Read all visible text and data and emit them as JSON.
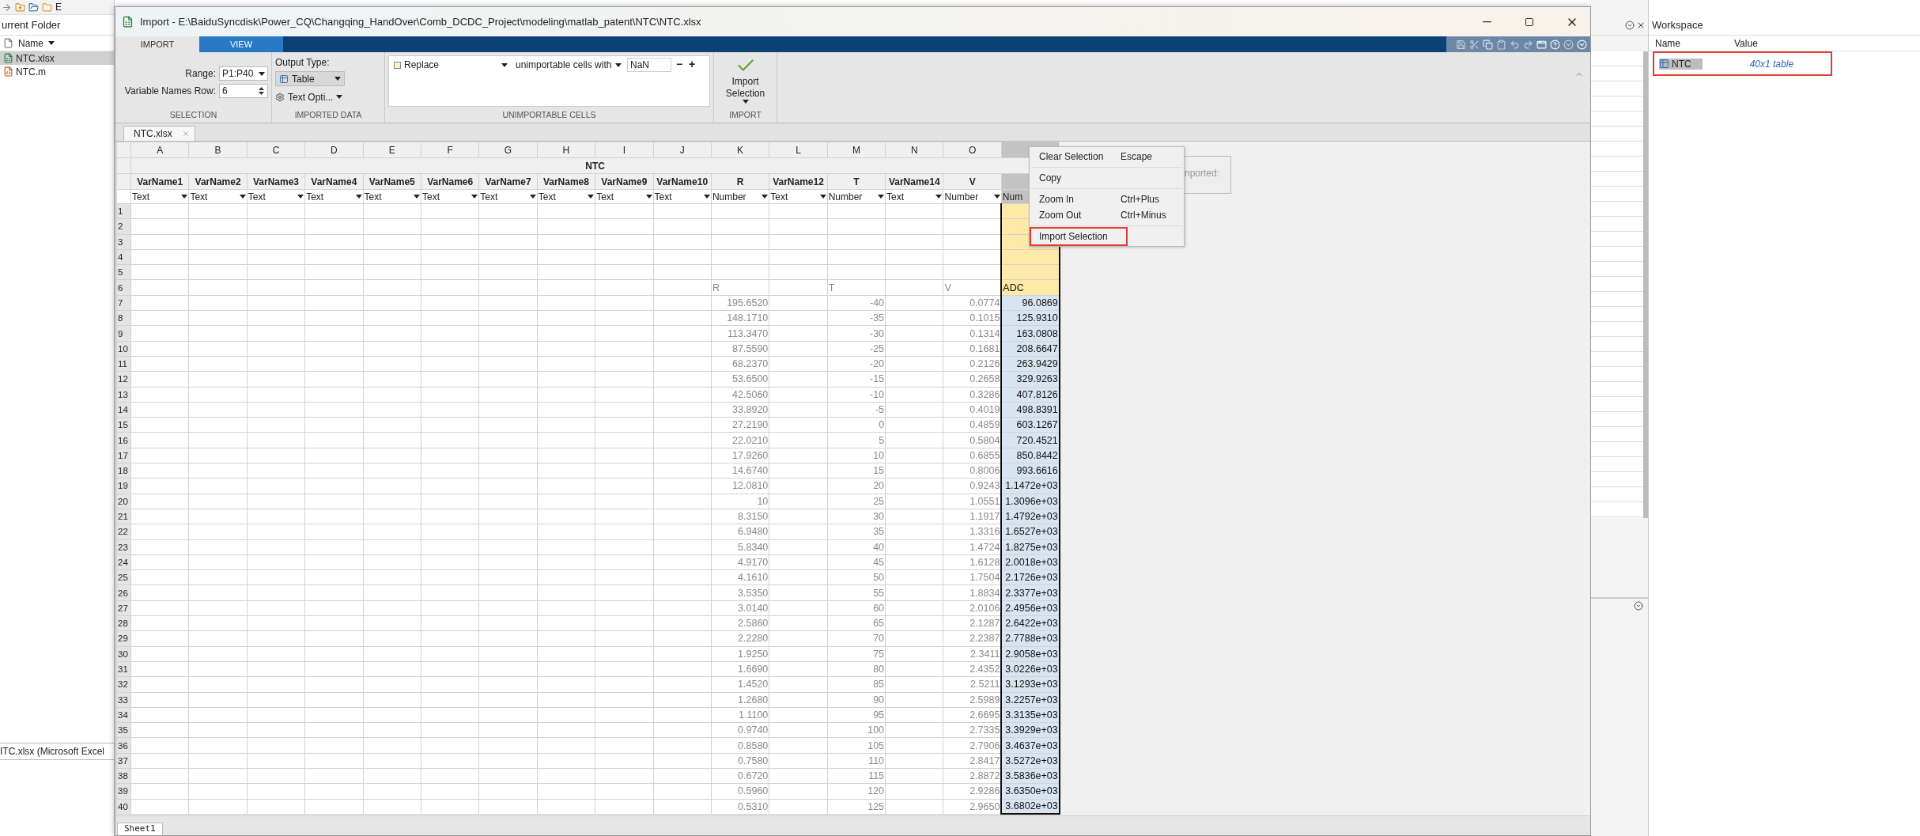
{
  "desktop": {
    "path_fragment": "E",
    "current_folder": {
      "title": "urrent Folder",
      "column": "Name",
      "files": [
        {
          "name": "NTC.xlsx",
          "kind": "excel",
          "selected": true
        },
        {
          "name": "NTC.m",
          "kind": "mfile",
          "selected": false
        }
      ],
      "details": "ITC.xlsx  (Microsoft Excel"
    },
    "workspace": {
      "title": "Workspace",
      "columns": [
        "Name",
        "Value"
      ],
      "variables": [
        {
          "name": "NTC",
          "value": "40x1 table",
          "selected": true,
          "highlighted": true
        }
      ]
    }
  },
  "dialog": {
    "title": "Import - E:\\BaiduSyncdisk\\Power_CQ\\Changqing_HandOver\\Comb_DCDC_Project\\modeling\\matlab_patent\\NTC\\NTC.xlsx",
    "tabs": [
      {
        "label": "IMPORT",
        "selected": true
      },
      {
        "label": "VIEW",
        "selected": false
      }
    ],
    "ribbon": {
      "range_label": "Range:",
      "range": "P1:P40",
      "names_row_label": "Variable Names Row:",
      "names_row": "6",
      "selection_section": "SELECTION",
      "output_label": "Output Type:",
      "output_type": "Table",
      "text_options": "Text Opti...",
      "imported_section": "IMPORTED DATA",
      "rule_action": "Replace",
      "rule_target": "unimportable cells with",
      "rule_value": "NaN",
      "remove": "−",
      "add": "+",
      "unimportable_section": "UNIMPORTABLE CELLS",
      "import_button": "Import Selection",
      "import_section": "IMPORT"
    },
    "document_tabs": [
      {
        "label": "NTC.xlsx",
        "selected": true
      }
    ],
    "sheet": {
      "title": "NTC",
      "columns": [
        {
          "letter": "A",
          "var_name": "VarName1",
          "type": "Text",
          "selected": false
        },
        {
          "letter": "B",
          "var_name": "VarName2",
          "type": "Text",
          "selected": false
        },
        {
          "letter": "C",
          "var_name": "VarName3",
          "type": "Text",
          "selected": false
        },
        {
          "letter": "D",
          "var_name": "VarName4",
          "type": "Text",
          "selected": false
        },
        {
          "letter": "E",
          "var_name": "VarName5",
          "type": "Text",
          "selected": false
        },
        {
          "letter": "F",
          "var_name": "VarName6",
          "type": "Text",
          "selected": false
        },
        {
          "letter": "G",
          "var_name": "VarName7",
          "type": "Text",
          "selected": false
        },
        {
          "letter": "H",
          "var_name": "VarName8",
          "type": "Text",
          "selected": false
        },
        {
          "letter": "I",
          "var_name": "VarName9",
          "type": "Text",
          "selected": false
        },
        {
          "letter": "J",
          "var_name": "VarName10",
          "type": "Text",
          "selected": false
        },
        {
          "letter": "K",
          "var_name": "R",
          "type": "Number",
          "selected": false
        },
        {
          "letter": "L",
          "var_name": "VarName12",
          "type": "Text",
          "selected": false
        },
        {
          "letter": "M",
          "var_name": "T",
          "type": "Number",
          "selected": false
        },
        {
          "letter": "N",
          "var_name": "VarName14",
          "type": "Text",
          "selected": false
        },
        {
          "letter": "O",
          "var_name": "V",
          "type": "Number",
          "selected": false
        },
        {
          "type": "Num",
          "selected": true
        }
      ],
      "rows": [
        {
          "number": "1",
          "kind": "header"
        },
        {
          "number": "2",
          "kind": "header"
        },
        {
          "number": "3",
          "kind": "header"
        },
        {
          "number": "4",
          "kind": "header"
        },
        {
          "number": "5",
          "kind": "header"
        },
        {
          "number": "6",
          "kind": "header",
          "values": {
            "K": "R",
            "M": "T",
            "O": "V",
            "P": "ADC"
          }
        },
        {
          "number": "7",
          "kind": "data",
          "values": {
            "K": "195.6520",
            "M": "-40",
            "O": "0.0774",
            "P": "96.0869"
          }
        },
        {
          "number": "8",
          "kind": "data",
          "values": {
            "K": "148.1710",
            "M": "-35",
            "O": "0.1015",
            "P": "125.9310"
          }
        },
        {
          "number": "9",
          "kind": "data",
          "values": {
            "K": "113.3470",
            "M": "-30",
            "O": "0.1314",
            "P": "163.0808"
          }
        },
        {
          "number": "10",
          "kind": "data",
          "values": {
            "K": "87.5590",
            "M": "-25",
            "O": "0.1681",
            "P": "208.6647"
          }
        },
        {
          "number": "11",
          "kind": "data",
          "values": {
            "K": "68.2370",
            "M": "-20",
            "O": "0.2126",
            "P": "263.9429"
          }
        },
        {
          "number": "12",
          "kind": "data",
          "values": {
            "K": "53.6500",
            "M": "-15",
            "O": "0.2658",
            "P": "329.9263"
          }
        },
        {
          "number": "13",
          "kind": "data",
          "values": {
            "K": "42.5060",
            "M": "-10",
            "O": "0.3286",
            "P": "407.8126"
          }
        },
        {
          "number": "14",
          "kind": "data",
          "values": {
            "K": "33.8920",
            "M": "-5",
            "O": "0.4019",
            "P": "498.8391"
          }
        },
        {
          "number": "15",
          "kind": "data",
          "values": {
            "K": "27.2190",
            "M": "0",
            "O": "0.4859",
            "P": "603.1267"
          }
        },
        {
          "number": "16",
          "kind": "data",
          "values": {
            "K": "22.0210",
            "M": "5",
            "O": "0.5804",
            "P": "720.4521"
          }
        },
        {
          "number": "17",
          "kind": "data",
          "values": {
            "K": "17.9260",
            "M": "10",
            "O": "0.6855",
            "P": "850.8442"
          }
        },
        {
          "number": "18",
          "kind": "data",
          "values": {
            "K": "14.6740",
            "M": "15",
            "O": "0.8006",
            "P": "993.6616"
          }
        },
        {
          "number": "19",
          "kind": "data",
          "values": {
            "K": "12.0810",
            "M": "20",
            "O": "0.9243",
            "P": "1.1472e+03"
          }
        },
        {
          "number": "20",
          "kind": "data",
          "values": {
            "K": "10",
            "M": "25",
            "O": "1.0551",
            "P": "1.3096e+03"
          }
        },
        {
          "number": "21",
          "kind": "data",
          "values": {
            "K": "8.3150",
            "M": "30",
            "O": "1.1917",
            "P": "1.4792e+03"
          }
        },
        {
          "number": "22",
          "kind": "data",
          "values": {
            "K": "6.9480",
            "M": "35",
            "O": "1.3316",
            "P": "1.6527e+03"
          }
        },
        {
          "number": "23",
          "kind": "data",
          "values": {
            "K": "5.8340",
            "M": "40",
            "O": "1.4724",
            "P": "1.8275e+03"
          }
        },
        {
          "number": "24",
          "kind": "data",
          "values": {
            "K": "4.9170",
            "M": "45",
            "O": "1.6128",
            "P": "2.0018e+03"
          }
        },
        {
          "number": "25",
          "kind": "data",
          "values": {
            "K": "4.1610",
            "M": "50",
            "O": "1.7504",
            "P": "2.1726e+03"
          }
        },
        {
          "number": "26",
          "kind": "data",
          "values": {
            "K": "3.5350",
            "M": "55",
            "O": "1.8834",
            "P": "2.3377e+03"
          }
        },
        {
          "number": "27",
          "kind": "data",
          "values": {
            "K": "3.0140",
            "M": "60",
            "O": "2.0106",
            "P": "2.4956e+03"
          }
        },
        {
          "number": "28",
          "kind": "data",
          "values": {
            "K": "2.5860",
            "M": "65",
            "O": "2.1287",
            "P": "2.6422e+03"
          }
        },
        {
          "number": "29",
          "kind": "data",
          "values": {
            "K": "2.2280",
            "M": "70",
            "O": "2.2387",
            "P": "2.7788e+03"
          }
        },
        {
          "number": "30",
          "kind": "data",
          "values": {
            "K": "1.9250",
            "M": "75",
            "O": "2.3411",
            "P": "2.9058e+03"
          }
        },
        {
          "number": "31",
          "kind": "data",
          "values": {
            "K": "1.6690",
            "M": "80",
            "O": "2.4352",
            "P": "3.0226e+03"
          }
        },
        {
          "number": "32",
          "kind": "data",
          "values": {
            "K": "1.4520",
            "M": "85",
            "O": "2.5211",
            "P": "3.1293e+03"
          }
        },
        {
          "number": "33",
          "kind": "data",
          "values": {
            "K": "1.2680",
            "M": "90",
            "O": "2.5989",
            "P": "3.2257e+03"
          }
        },
        {
          "number": "34",
          "kind": "data",
          "values": {
            "K": "1.1100",
            "M": "95",
            "O": "2.6695",
            "P": "3.3135e+03"
          }
        },
        {
          "number": "35",
          "kind": "data",
          "values": {
            "K": "0.9740",
            "M": "100",
            "O": "2.7335",
            "P": "3.3929e+03"
          }
        },
        {
          "number": "36",
          "kind": "data",
          "values": {
            "K": "0.8580",
            "M": "105",
            "O": "2.7906",
            "P": "3.4637e+03"
          }
        },
        {
          "number": "37",
          "kind": "data",
          "values": {
            "K": "0.7580",
            "M": "110",
            "O": "2.8417",
            "P": "3.5272e+03"
          }
        },
        {
          "number": "38",
          "kind": "data",
          "values": {
            "K": "0.6720",
            "M": "115",
            "O": "2.8872",
            "P": "3.5836e+03"
          }
        },
        {
          "number": "39",
          "kind": "data",
          "values": {
            "K": "0.5960",
            "M": "120",
            "O": "2.9286",
            "P": "3.6350e+03"
          }
        },
        {
          "number": "40",
          "kind": "data",
          "values": {
            "K": "0.5310",
            "M": "125",
            "O": "2.9650",
            "P": "3.6802e+03"
          }
        }
      ]
    },
    "hint": "nported:",
    "context_menu": {
      "groups": [
        [
          {
            "label": "Clear Selection",
            "shortcut": "Escape",
            "highlighted": false
          }
        ],
        [
          {
            "label": "Copy",
            "highlighted": false
          }
        ],
        [
          {
            "label": "Zoom In",
            "shortcut": "Ctrl+Plus",
            "highlighted": false
          },
          {
            "label": "Zoom Out",
            "shortcut": "Ctrl+Minus",
            "highlighted": false
          }
        ],
        [
          {
            "label": "Import Selection",
            "highlighted": true
          }
        ]
      ]
    },
    "sheet_tabs": [
      {
        "label": "Sheet1",
        "selected": true
      }
    ]
  }
}
